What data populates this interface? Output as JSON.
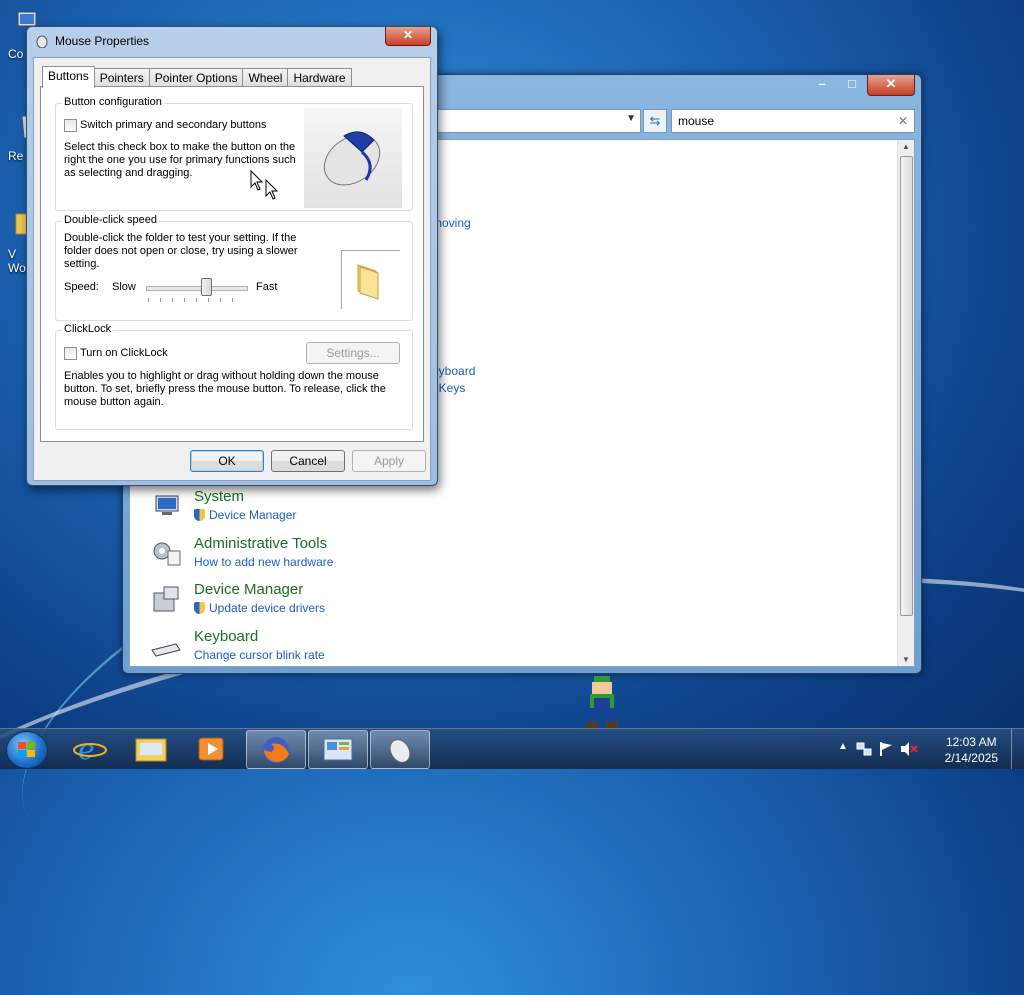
{
  "desktop": {
    "icons": [
      {
        "label": "Co"
      },
      {
        "label": "Re"
      },
      {
        "label": "V\nWo"
      }
    ]
  },
  "control_panel": {
    "search_value": "mouse",
    "partial_links": [
      "moving",
      "eyboard",
      "eKeys"
    ],
    "items": [
      {
        "title": "System",
        "link": "Device Manager",
        "icon": "computer-icon",
        "shield": true
      },
      {
        "title": "Administrative Tools",
        "link": "How to add new hardware",
        "icon": "admin-tools-icon",
        "shield": false
      },
      {
        "title": "Device Manager",
        "link": "Update device drivers",
        "icon": "device-manager-icon",
        "shield": true
      },
      {
        "title": "Keyboard",
        "link": "Change cursor blink rate",
        "icon": "keyboard-icon",
        "shield": false
      }
    ],
    "controls": {
      "minimize": "–",
      "maximize": "□",
      "close": "✕"
    }
  },
  "dialog": {
    "title": "Mouse Properties",
    "close_label": "✕",
    "tabs": [
      "Buttons",
      "Pointers",
      "Pointer Options",
      "Wheel",
      "Hardware"
    ],
    "active_tab": "Buttons",
    "button_config": {
      "group_label": "Button configuration",
      "checkbox_label": "Switch primary and secondary buttons",
      "checked": false,
      "description": "Select this check box to make the button on the right the one you use for primary functions such as selecting and dragging."
    },
    "double_click": {
      "group_label": "Double-click speed",
      "description": "Double-click the folder to test your setting. If the folder does not open or close, try using a slower setting.",
      "speed_label": "Speed:",
      "slow_label": "Slow",
      "fast_label": "Fast",
      "slider_value": 0.6
    },
    "clicklock": {
      "group_label": "ClickLock",
      "checkbox_label": "Turn on ClickLock",
      "checked": false,
      "settings_label": "Settings...",
      "description": "Enables you to highlight or drag without holding down the mouse button. To set, briefly press the mouse button. To release, click the mouse button again."
    },
    "buttons": {
      "ok": "OK",
      "cancel": "Cancel",
      "apply": "Apply"
    }
  },
  "taskbar": {
    "apps": [
      "ie-icon",
      "explorer-icon",
      "media-player-icon",
      "firefox-icon",
      "control-panel-icon",
      "mouse-icon"
    ],
    "time": "12:03 AM",
    "date": "2/14/2025",
    "tray_icons": [
      "show-hidden-icons-icon",
      "network-icon",
      "action-center-flag-icon",
      "volume-muted-icon"
    ]
  }
}
